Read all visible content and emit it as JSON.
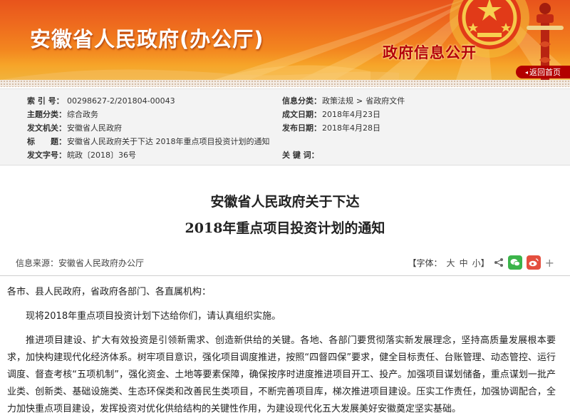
{
  "header": {
    "site_title": "安徽省人民政府(办公厅)",
    "section_title": "政府信息公开",
    "back_home": "返回首页",
    "colors": {
      "banner_top": "#e8541c",
      "banner_bottom": "#f1b33c",
      "accent_red": "#b30000"
    }
  },
  "metadata": {
    "index_no": {
      "label": "索 引 号：",
      "value": "00298627-2/201804-00043"
    },
    "category": {
      "label": "主题分类：",
      "value": "综合政务"
    },
    "issuer": {
      "label": "发文机关：",
      "value": "安徽省人民政府"
    },
    "title": {
      "label": "标　　题：",
      "value": "安徽省人民政府关于下达 2018年重点项目投资计划的通知"
    },
    "doc_no": {
      "label": "发文字号：",
      "value": "皖政〔2018〕36号"
    },
    "info_class": {
      "label": "信息分类：",
      "value_a": "政策法规",
      "sep": ">",
      "value_b": "省政府文件"
    },
    "created_date": {
      "label": "成文日期：",
      "value": "2018年4月23日"
    },
    "publish_date": {
      "label": "发布日期：",
      "value": "2018年4月28日"
    },
    "keywords": {
      "label": "关 键 词：",
      "value": ""
    }
  },
  "article": {
    "title_line1": "安徽省人民政府关于下达",
    "title_line2": "2018年重点项目投资计划的通知",
    "source": "信息来源：安徽省人民政府办公厅",
    "font_label": "【字体：",
    "font_large": "大",
    "font_medium": "中",
    "font_small": "小】",
    "salutation": "各市、县人民政府，省政府各部门、各直属机构：",
    "para1": "现将2018年重点项目投资计划下达给你们，请认真组织实施。",
    "para2": "推进项目建设、扩大有效投资是引领新需求、创造新供给的关键。各地、各部门要贯彻落实新发展理念，坚持高质量发展根本要求，加快构建现代化经济体系。树牢项目意识，强化项目调度推进，按照“四督四保”要求，健全目标责任、台账管理、动态管控、运行调度、督查考核“五项机制”，强化资金、土地等要素保障，确保按序时进度推进项目开工、投产。加强项目谋划储备，重点谋划一批产业类、创新类、基础设施类、生态环保类和改善民生类项目，不断完善项目库，梯次推进项目建设。压实工作责任，加强协调配合，全力加快重点项目建设，发挥投资对优化供给结构的关键性作用，为建设现代化五大发展美好安徽奠定坚实基础。"
  }
}
